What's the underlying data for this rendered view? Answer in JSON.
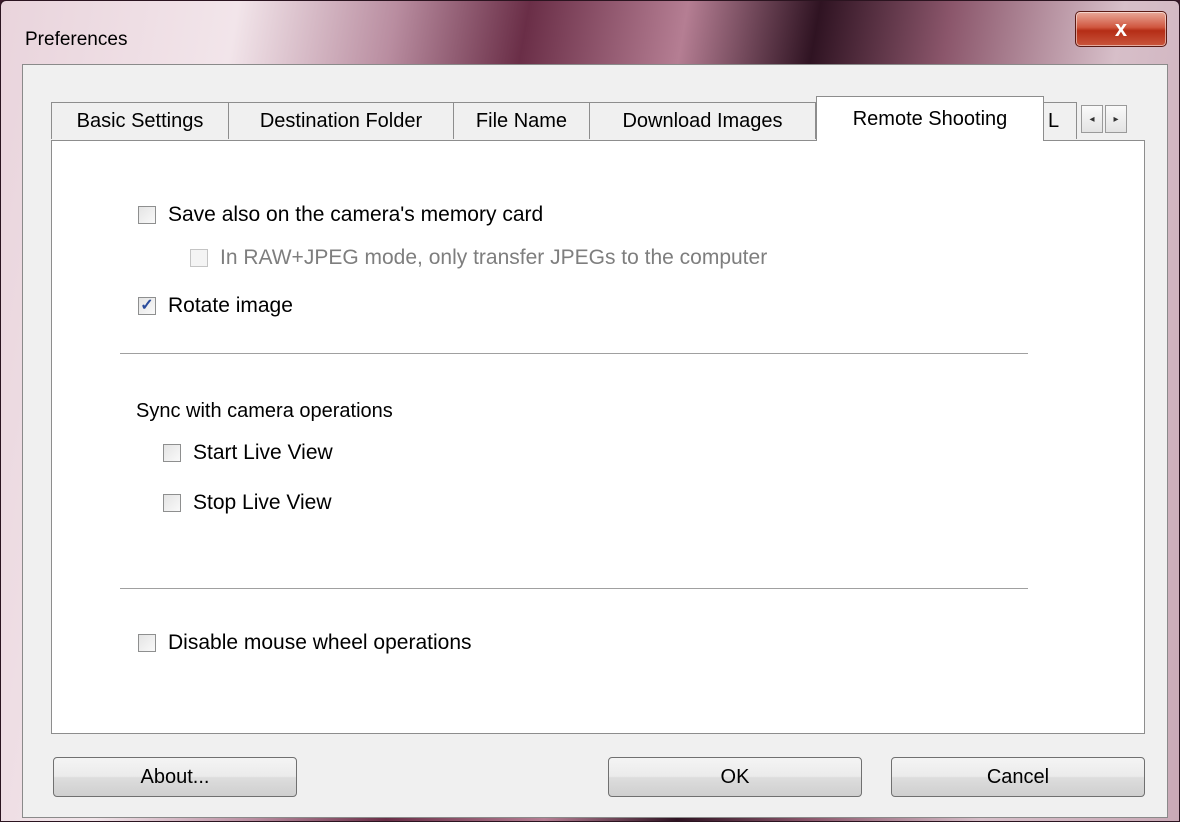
{
  "window": {
    "title": "Preferences",
    "close_glyph": "x"
  },
  "tabs": [
    {
      "label": "Basic Settings",
      "active": false
    },
    {
      "label": "Destination Folder",
      "active": false
    },
    {
      "label": "File Name",
      "active": false
    },
    {
      "label": "Download Images",
      "active": false
    },
    {
      "label": "Remote Shooting",
      "active": true
    },
    {
      "label": "L",
      "active": false
    }
  ],
  "tab_scroll": {
    "left_glyph": "◂",
    "right_glyph": "▸"
  },
  "remote_shooting": {
    "save_on_card": {
      "label": "Save also on the camera's memory card",
      "checked": false
    },
    "raw_jpeg_only": {
      "label": "In RAW+JPEG mode, only transfer JPEGs to the computer",
      "checked": false,
      "enabled": false
    },
    "rotate_image": {
      "label": "Rotate image",
      "checked": true
    },
    "sync_label": "Sync with camera operations",
    "start_live_view": {
      "label": "Start Live View",
      "checked": false
    },
    "stop_live_view": {
      "label": "Stop Live View",
      "checked": false
    },
    "disable_mouse_wheel": {
      "label": "Disable mouse wheel operations",
      "checked": false
    }
  },
  "buttons": {
    "about": "About...",
    "ok": "OK",
    "cancel": "Cancel"
  },
  "check_glyph": "✓"
}
